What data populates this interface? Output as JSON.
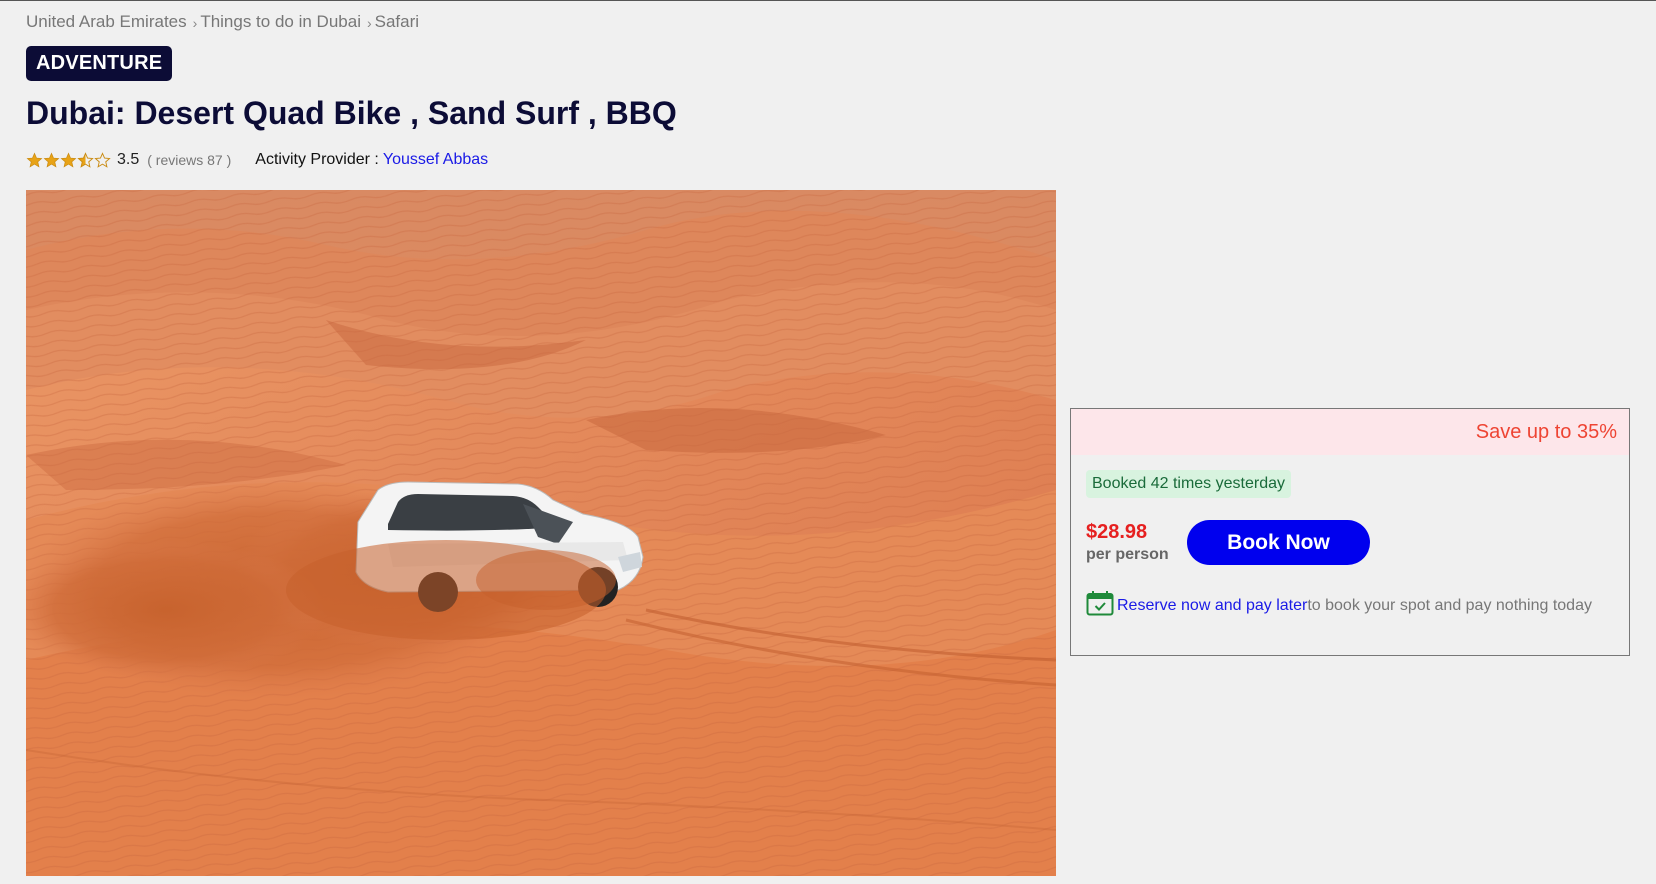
{
  "breadcrumb": {
    "items": [
      "United Arab Emirates",
      "Things to do in Dubai",
      "Safari"
    ]
  },
  "badge": "ADVENTURE",
  "title": "Dubai: Desert Quad Bike , Sand Surf , BBQ",
  "rating": {
    "stars": 3.5,
    "value": "3.5",
    "reviews": "( reviews 87 )",
    "star_color": "#e8a317"
  },
  "provider": {
    "label": "Activity Provider :",
    "name": "Youssef Abbas"
  },
  "hero_image": {
    "icon": "desert-suv-photo"
  },
  "booking": {
    "save_text": "Save up to 35%",
    "booked_text": "Booked 42 times yesterday",
    "price": "$28.98",
    "per_person": "per person",
    "book_button": "Book Now",
    "reserve_link": "Reserve now and pay later",
    "reserve_text": "to book your spot and pay nothing today",
    "calendar_icon": "calendar-check-icon"
  },
  "colors": {
    "accent_blue": "#0000ee",
    "price_red": "#e62020",
    "save_red": "#ee4433",
    "badge_navy": "#0c0c36"
  }
}
